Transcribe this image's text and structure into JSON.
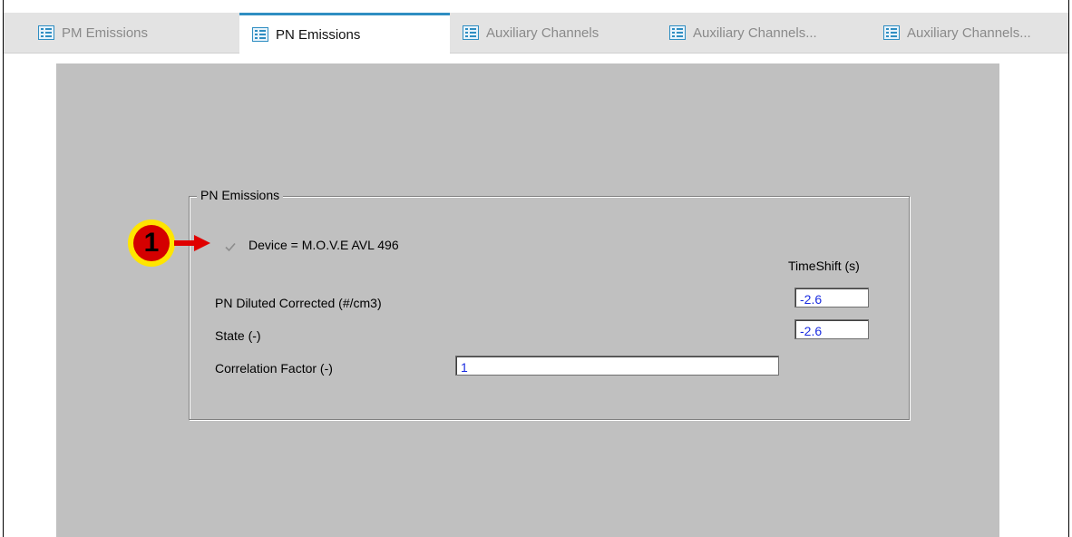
{
  "tabs": [
    {
      "label": "PM Emissions",
      "active": false
    },
    {
      "label": "PN Emissions",
      "active": true
    },
    {
      "label": "Auxiliary Channels",
      "active": false
    },
    {
      "label": "Auxiliary Channels...",
      "active": false
    },
    {
      "label": "Auxiliary Channels...",
      "active": false
    }
  ],
  "group": {
    "title": "PN Emissions",
    "device_label": "Device = M.O.V.E AVL 496",
    "device_checked": true,
    "timeshift_header": "TimeShift (s)",
    "rows": [
      {
        "label": "PN Diluted Corrected (#/cm3)",
        "timeshift": "-2.6"
      },
      {
        "label": "State (-)",
        "timeshift": "-2.6"
      }
    ],
    "correlation_label": "Correlation Factor (-)",
    "correlation_value": "1"
  },
  "callout": {
    "number": "1",
    "badge_color": "#ffe500",
    "arrow_color": "#e00000"
  },
  "colors": {
    "accent": "#2f8ec2",
    "panel": "#c0c0c0",
    "value_text": "#1b2de0"
  }
}
